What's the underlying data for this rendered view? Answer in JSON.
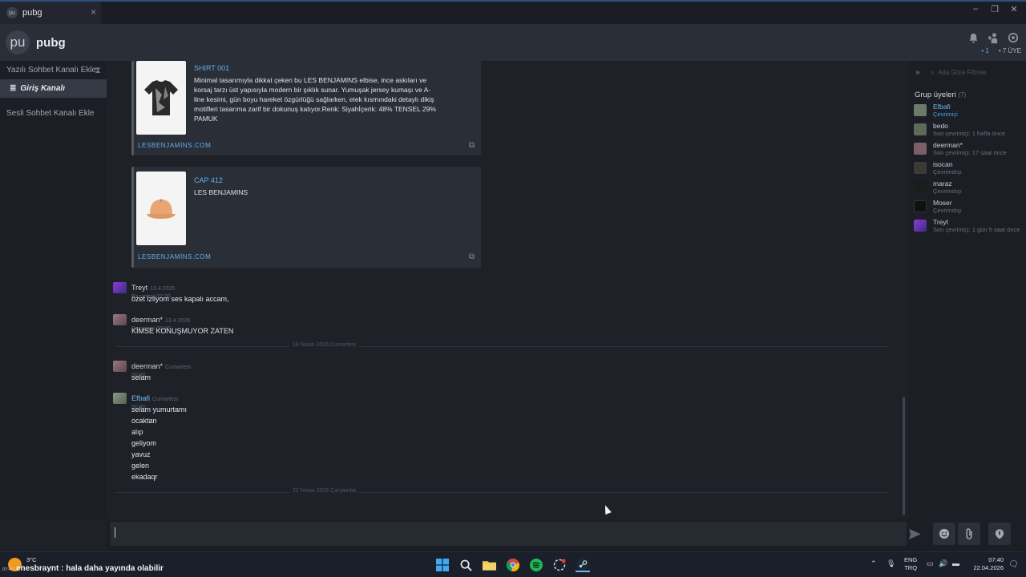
{
  "window": {
    "tab_title": "pubg",
    "tab_icon_text": "pu"
  },
  "header": {
    "avatar_text": "pu",
    "group_name": "pubg",
    "online_count": "• 1",
    "member_count": "• 7 ÜYE"
  },
  "left": {
    "add_text_channel": "Yazılı Sohbet Kanalı Ekle",
    "active_channel": "Giriş Kanalı",
    "add_voice_channel": "Sesli Sohbet Kanalı Ekle"
  },
  "embeds": [
    {
      "title": "SHIRT 001",
      "desc": "Minimal tasarımıyla dikkat çeken bu LES BENJAMINS elbise, ince askıları ve\nkorsaj tarzı üst yapısıyla modern bir şıklık sunar. Yumuşak jersey kumaşı ve A-\nline kesimi, gün boyu hareket özgürlüğü sağlarken, etek kısmındaki detaylı dikiş\nmotifleri tasarıma zarif bir dokunuş katıyor.Renk: Siyahİçerik: 48% TENSEL 29%\nPAMUK",
      "site": "LESBENJAMİNS.COM"
    },
    {
      "title": "CAP 412",
      "desc": "LES BENJAMINS",
      "site": "LESBENJAMİNS.COM"
    }
  ],
  "messages": [
    {
      "author": "Treyt",
      "time": "13.4.2026 Pazartesi 02:30",
      "lines": [
        "özet izliyom ses kapalı accam,"
      ]
    },
    {
      "author": "deerman*",
      "time": "13.4.2026 Pazartesi 02:30",
      "lines": [
        "KİMSE KONUŞMUYOR ZATEN"
      ]
    },
    {
      "author": "deerman*",
      "time": "Cumartesi 00:30",
      "lines": [
        "selam"
      ]
    },
    {
      "author": "Efbafi",
      "time": "Cumartesi 00:30",
      "lines": [
        "selam yumurtamı",
        "ocaktan",
        "alıp",
        "geliyom",
        "yavuz",
        "gelen",
        "ekadaqr"
      ]
    }
  ],
  "dividers": [
    "18 Nisan 2026 Cumartesi",
    "22 Nisan 2026 Çarşamba"
  ],
  "members": {
    "filter_placeholder": "Ada Göre Filtrele",
    "heading": "Grup üyeleri",
    "count": "(7)",
    "list": [
      {
        "name": "Efbafi",
        "status": "Çevrimiçi",
        "online": true,
        "color": "#6b7b6a"
      },
      {
        "name": "bedo",
        "status": "Son çevrimiçi: 1 hafta önce",
        "online": false,
        "color": "#5d6a56"
      },
      {
        "name": "deerman*",
        "status": "Son çevrimiçi: 17 saat önce",
        "online": false,
        "color": "#7b5f66"
      },
      {
        "name": "isocan",
        "status": "Çevrimdışı",
        "online": false,
        "color": "#3d3a36"
      },
      {
        "name": "maraz",
        "status": "Çevrimdışı",
        "online": false,
        "color": "#1c1c1c"
      },
      {
        "name": "Moser",
        "status": "Çevrimdışı",
        "online": false,
        "color": "#111111"
      },
      {
        "name": "Treyt",
        "status": "Son çevrimiçi: 1 gün 5 saat önce",
        "online": false,
        "color": "#6b3fa0"
      }
    ]
  },
  "taskbar": {
    "temperature": "3°C",
    "tiny_time": "07:40",
    "toast": "enesbraynt : hala daha yayında olabilir",
    "lang_top": "ENG",
    "lang_bottom": "TRQ",
    "time": "07:40",
    "date": "22.04.2026"
  },
  "colors": {
    "accent": "#62b0ef",
    "bg": "#1e2128",
    "panel": "#1b1e24"
  }
}
